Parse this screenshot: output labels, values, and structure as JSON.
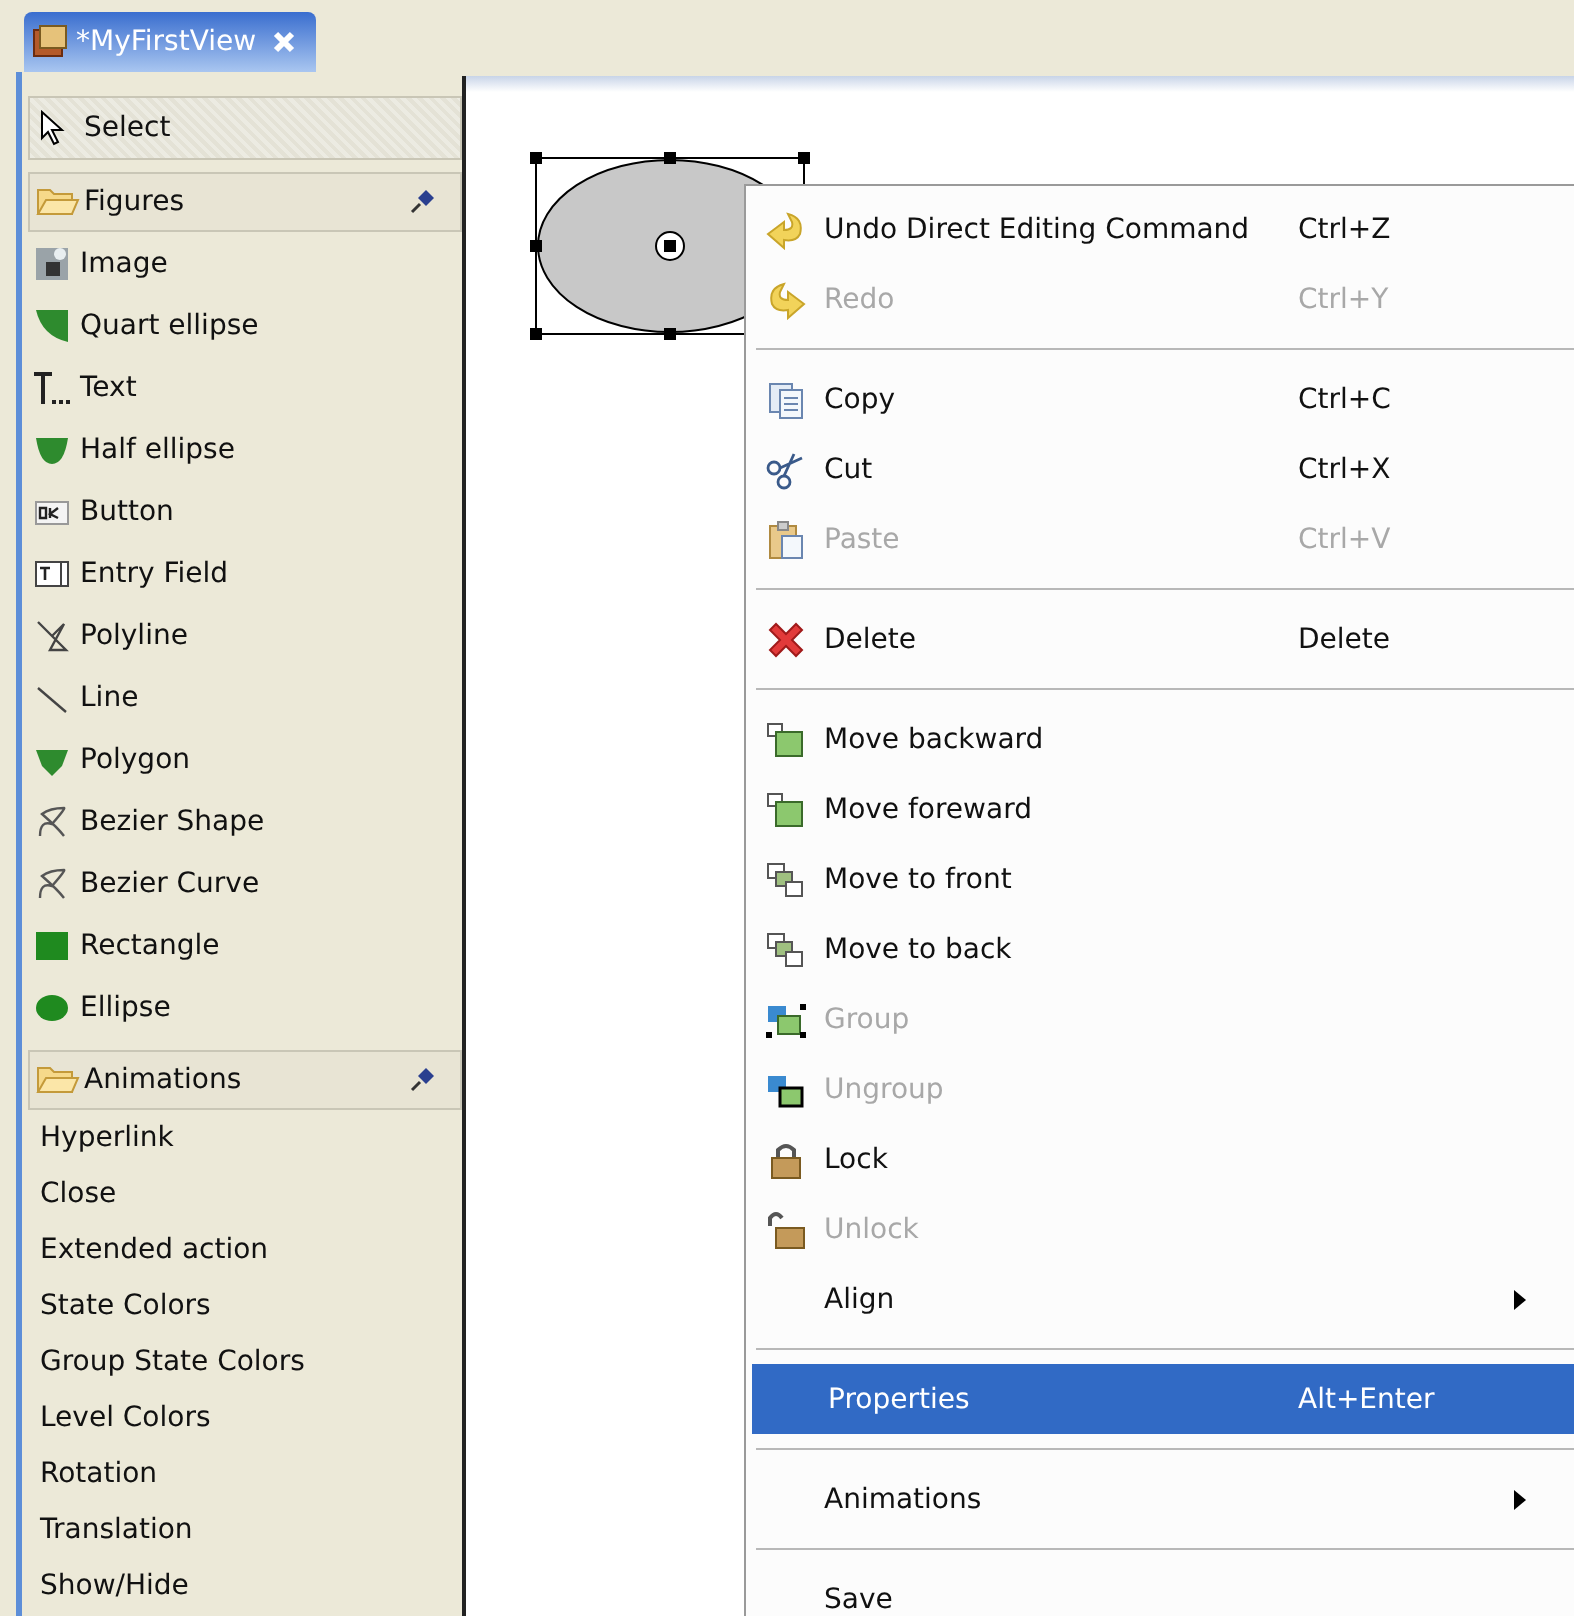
{
  "editor_tab": {
    "title": "*MyFirstView",
    "selected": true
  },
  "palette": {
    "select_tool": {
      "label": "Select"
    },
    "drawers": [
      {
        "title": "Figures",
        "pinned": true,
        "items": [
          {
            "label": "Image",
            "kind": "image"
          },
          {
            "label": "Quart ellipse",
            "kind": "quart-ellipse"
          },
          {
            "label": "Text",
            "kind": "text"
          },
          {
            "label": "Half ellipse",
            "kind": "half-ellipse"
          },
          {
            "label": "Button",
            "kind": "button"
          },
          {
            "label": "Entry Field",
            "kind": "entry-field"
          },
          {
            "label": "Polyline",
            "kind": "polyline"
          },
          {
            "label": "Line",
            "kind": "line"
          },
          {
            "label": "Polygon",
            "kind": "polygon"
          },
          {
            "label": "Bezier Shape",
            "kind": "bezier"
          },
          {
            "label": "Bezier Curve",
            "kind": "bezier"
          },
          {
            "label": "Rectangle",
            "kind": "rectangle"
          },
          {
            "label": "Ellipse",
            "kind": "ellipse"
          }
        ]
      },
      {
        "title": "Animations",
        "pinned": true,
        "items": [
          {
            "label": "Hyperlink"
          },
          {
            "label": "Close"
          },
          {
            "label": "Extended action"
          },
          {
            "label": "State Colors"
          },
          {
            "label": "Group State Colors"
          },
          {
            "label": "Level Colors"
          },
          {
            "label": "Rotation"
          },
          {
            "label": "Translation"
          },
          {
            "label": "Show/Hide"
          }
        ]
      }
    ]
  },
  "context_menu": {
    "items": [
      {
        "kind": "undo",
        "label": "Undo Direct Editing Command",
        "shortcut": "Ctrl+Z",
        "disabled": false,
        "selected": false,
        "submenu": false
      },
      {
        "kind": "redo",
        "label": "Redo",
        "shortcut": "Ctrl+Y",
        "disabled": true,
        "selected": false,
        "submenu": false
      },
      {
        "kind": "separator"
      },
      {
        "kind": "copy",
        "label": "Copy",
        "shortcut": "Ctrl+C",
        "disabled": false,
        "selected": false,
        "submenu": false
      },
      {
        "kind": "cut",
        "label": "Cut",
        "shortcut": "Ctrl+X",
        "disabled": false,
        "selected": false,
        "submenu": false
      },
      {
        "kind": "paste",
        "label": "Paste",
        "shortcut": "Ctrl+V",
        "disabled": true,
        "selected": false,
        "submenu": false
      },
      {
        "kind": "separator"
      },
      {
        "kind": "delete",
        "label": "Delete",
        "shortcut": "Delete",
        "disabled": false,
        "selected": false,
        "submenu": false
      },
      {
        "kind": "separator"
      },
      {
        "kind": "move-backward",
        "label": "Move backward",
        "disabled": false,
        "selected": false,
        "submenu": false
      },
      {
        "kind": "move-forward",
        "label": "Move foreward",
        "disabled": false,
        "selected": false,
        "submenu": false
      },
      {
        "kind": "move-front",
        "label": "Move to front",
        "disabled": false,
        "selected": false,
        "submenu": false
      },
      {
        "kind": "move-back",
        "label": "Move to back",
        "disabled": false,
        "selected": false,
        "submenu": false
      },
      {
        "kind": "group",
        "label": "Group",
        "disabled": true,
        "selected": false,
        "submenu": false
      },
      {
        "kind": "ungroup",
        "label": "Ungroup",
        "disabled": true,
        "selected": false,
        "submenu": false
      },
      {
        "kind": "lock",
        "label": "Lock",
        "disabled": false,
        "selected": false,
        "submenu": false
      },
      {
        "kind": "unlock",
        "label": "Unlock",
        "disabled": true,
        "selected": false,
        "submenu": false
      },
      {
        "kind": "plain",
        "label": "Align",
        "disabled": false,
        "selected": false,
        "submenu": true
      },
      {
        "kind": "separator"
      },
      {
        "kind": "plain",
        "label": "Properties",
        "shortcut": "Alt+Enter",
        "disabled": false,
        "selected": true,
        "submenu": false
      },
      {
        "kind": "separator"
      },
      {
        "kind": "plain",
        "label": "Animations",
        "disabled": false,
        "selected": false,
        "submenu": true
      },
      {
        "kind": "separator"
      },
      {
        "kind": "plain",
        "label": "Save",
        "disabled": false,
        "selected": false,
        "submenu": false
      }
    ]
  }
}
